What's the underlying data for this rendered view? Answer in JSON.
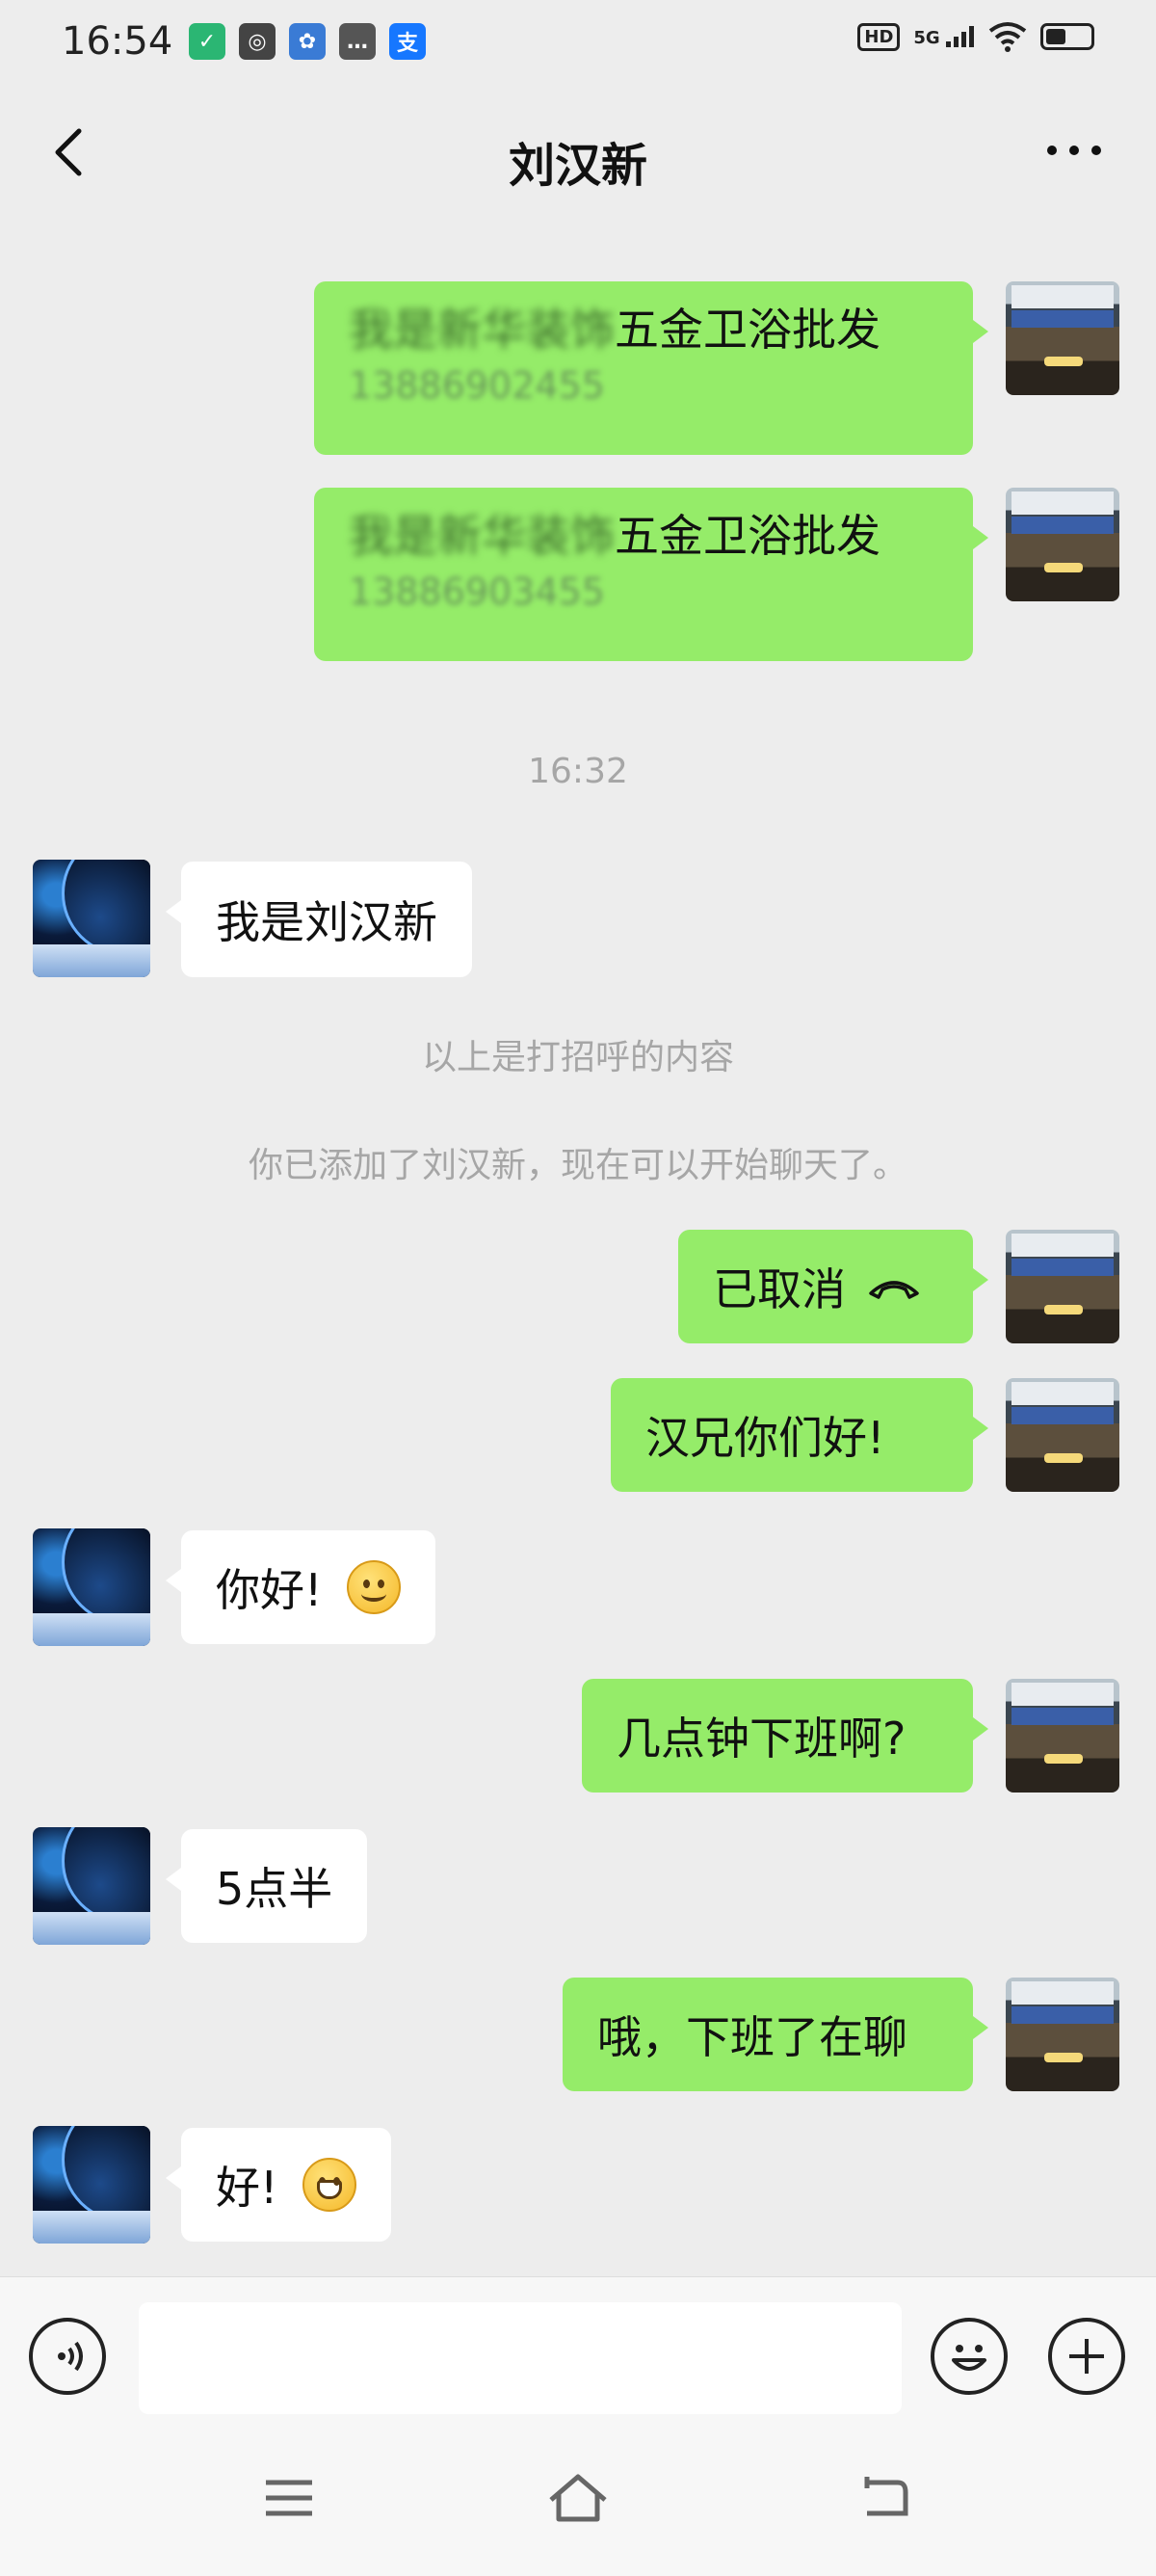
{
  "status_bar": {
    "time": "16:54",
    "network": "5G",
    "hd": "HD",
    "battery_level": 0.45,
    "app_icons": [
      {
        "name": "shield-app-icon",
        "color": "#2bb673",
        "glyph": "U"
      },
      {
        "name": "sync-app-icon",
        "color": "#444444",
        "glyph": "◎"
      },
      {
        "name": "paw-app-icon",
        "color": "#3a7bd5",
        "glyph": "✿"
      },
      {
        "name": "chat-app-icon",
        "color": "#555555",
        "glyph": "…"
      },
      {
        "name": "alipay-app-icon",
        "color": "#1677ff",
        "glyph": "支"
      }
    ]
  },
  "header": {
    "title": "刘汉新"
  },
  "messages": [
    {
      "side": "me",
      "type": "card",
      "line1_blurred": "我是新华装饰",
      "line1": "五金卫浴批发",
      "line2": "13886902455"
    },
    {
      "side": "me",
      "type": "card",
      "line1_blurred": "我是新华装饰",
      "line1": "五金卫浴批发",
      "line2": "13886903455"
    },
    {
      "type": "time",
      "text": "16:32"
    },
    {
      "side": "other",
      "text": "我是刘汉新"
    },
    {
      "type": "system",
      "text": "以上是打招呼的内容"
    },
    {
      "type": "system",
      "text": "你已添加了刘汉新，现在可以开始聊天了。"
    },
    {
      "side": "me",
      "text": "已取消",
      "icon": "hangup-phone-icon"
    },
    {
      "side": "me",
      "text": "汉兄你们好!"
    },
    {
      "side": "other",
      "text": "你好!",
      "emoji": "smile-emoji-icon"
    },
    {
      "side": "me",
      "text": "几点钟下班啊?"
    },
    {
      "side": "other",
      "text": "5点半"
    },
    {
      "side": "me",
      "text": "哦，下班了在聊"
    },
    {
      "side": "other",
      "text": "好!",
      "emoji": "grin-emoji-icon"
    }
  ],
  "input_bar": {
    "placeholder": ""
  },
  "colors": {
    "background": "#ededed",
    "my_bubble": "#95ec69",
    "other_bubble": "#ffffff",
    "system_text": "#a6a6a6"
  }
}
